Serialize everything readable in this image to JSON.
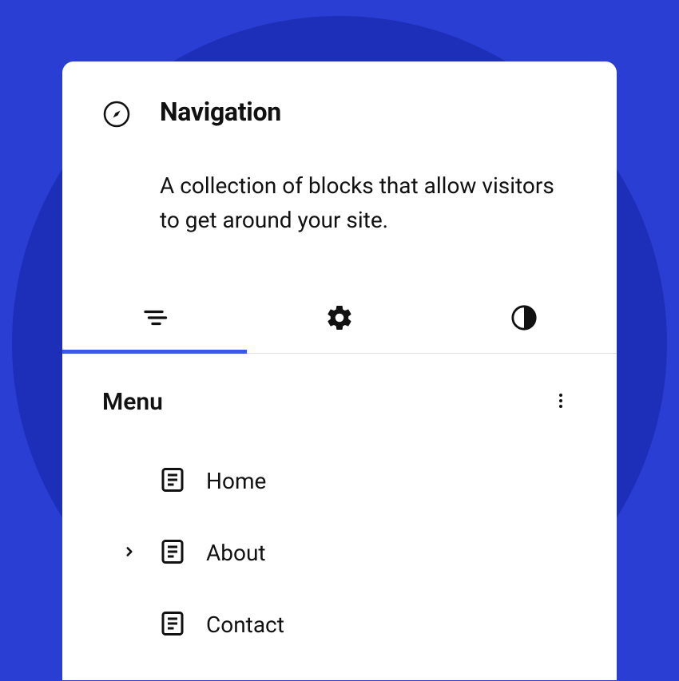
{
  "header": {
    "title": "Navigation",
    "description": "A collection of blocks that allow visitors to get around your site."
  },
  "tabs": {
    "list_label": "list",
    "settings_label": "settings",
    "styles_label": "styles"
  },
  "menu": {
    "heading": "Menu",
    "items": [
      {
        "label": "Home",
        "has_children": false
      },
      {
        "label": "About",
        "has_children": true
      },
      {
        "label": "Contact",
        "has_children": false
      }
    ]
  }
}
